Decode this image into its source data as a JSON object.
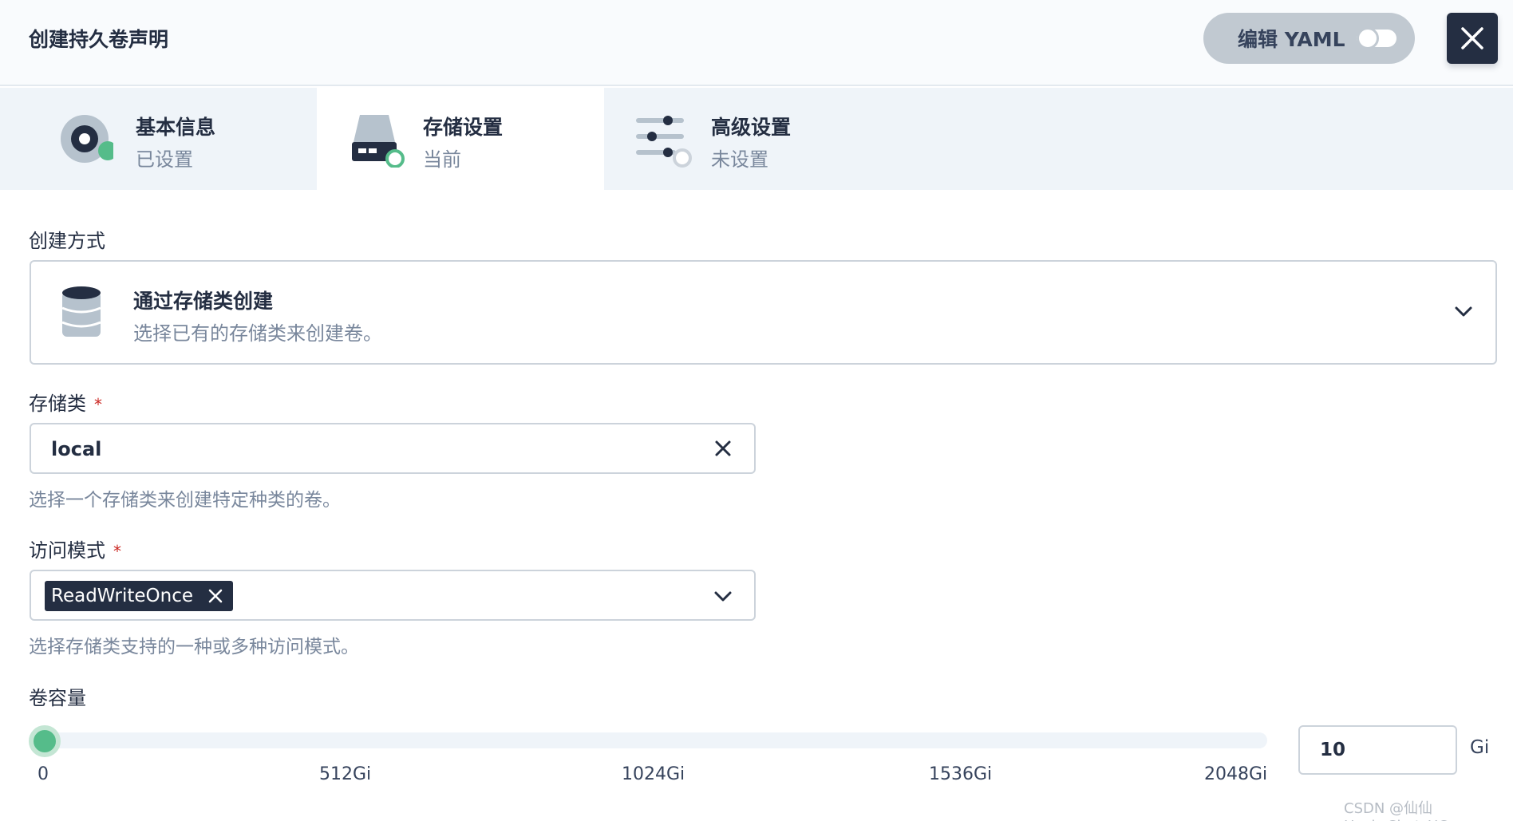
{
  "header": {
    "title": "创建持久卷声明",
    "yaml_label": "编辑 YAML"
  },
  "steps": [
    {
      "name": "基本信息",
      "status": "已设置",
      "icon": "disc-icon"
    },
    {
      "name": "存储设置",
      "status": "当前",
      "icon": "hard-drive-icon"
    },
    {
      "name": "高级设置",
      "status": "未设置",
      "icon": "sliders-icon"
    }
  ],
  "form": {
    "method": {
      "label": "创建方式",
      "title": "通过存储类创建",
      "description": "选择已有的存储类来创建卷。",
      "icon": "database-icon"
    },
    "storage_class": {
      "label": "存储类",
      "required_mark": "*",
      "value": "local",
      "hint": "选择一个存储类来创建特定种类的卷。"
    },
    "access_mode": {
      "label": "访问模式",
      "required_mark": "*",
      "tag": "ReadWriteOnce",
      "hint": "选择存储类支持的一种或多种访问模式。"
    },
    "capacity": {
      "label": "卷容量",
      "value": "10",
      "value_fraction": 0.005,
      "unit": "Gi",
      "ticks": [
        "0",
        "512Gi",
        "1024Gi",
        "1536Gi",
        "2048Gi"
      ]
    }
  },
  "watermark": "CSDN @仙仙Hack_Chat_UC",
  "colors": {
    "dark": "#242e42",
    "green": "#55bc8a",
    "muted": "#79879c",
    "border": "#ccd3db",
    "required": "#ca2621"
  }
}
